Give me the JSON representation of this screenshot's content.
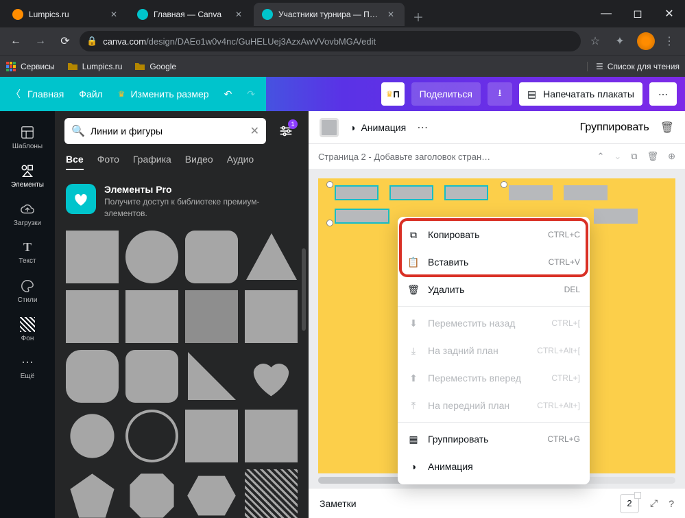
{
  "browser": {
    "tabs": [
      {
        "title": "Lumpics.ru",
        "favicon": "#ff8c00"
      },
      {
        "title": "Главная — Canva",
        "favicon": "#00c4cc"
      },
      {
        "title": "Участники турнира — Плакат",
        "favicon": "#00c4cc",
        "active": true
      }
    ],
    "url_host": "canva.com",
    "url_path": "/design/DAEo1w0v4nc/GuHELUej3AzxAwVVovbMGA/edit",
    "bookmarks": {
      "services": "Сервисы",
      "b1": "Lumpics.ru",
      "b2": "Google",
      "reading": "Список для чтения"
    }
  },
  "topbar": {
    "home": "Главная",
    "file": "Файл",
    "resize": "Изменить размер",
    "share": "Поделиться",
    "print": "Напечатать плакаты",
    "premium_hint": "П"
  },
  "rail": {
    "templates": "Шаблоны",
    "elements": "Элементы",
    "uploads": "Загрузки",
    "text": "Текст",
    "styles": "Стили",
    "background": "Фон",
    "more": "Ещё"
  },
  "panel": {
    "search_value": "Линии и фигуры",
    "filter_count": "1",
    "cats": {
      "all": "Все",
      "photo": "Фото",
      "graphics": "Графика",
      "video": "Видео",
      "audio": "Аудио"
    },
    "promo_title": "Элементы Pro",
    "promo_desc": "Получите доступ к библиотеке премиум-элементов."
  },
  "canvas_toolbar": {
    "animation": "Анимация",
    "group": "Группировать"
  },
  "page": {
    "title": "Страница 2 - Добавьте заголовок стран…"
  },
  "ctx": {
    "copy": "Копировать",
    "copy_k": "CTRL+C",
    "paste": "Вставить",
    "paste_k": "CTRL+V",
    "delete": "Удалить",
    "delete_k": "DEL",
    "back": "Переместить назад",
    "back_k": "CTRL+[",
    "toback": "На задний план",
    "toback_k": "CTRL+Alt+[",
    "fwd": "Переместить вперед",
    "fwd_k": "CTRL+]",
    "tofront": "На передний план",
    "tofront_k": "CTRL+Alt+]",
    "group": "Группировать",
    "group_k": "CTRL+G",
    "anim": "Анимация"
  },
  "footer": {
    "notes": "Заметки",
    "page": "2"
  }
}
